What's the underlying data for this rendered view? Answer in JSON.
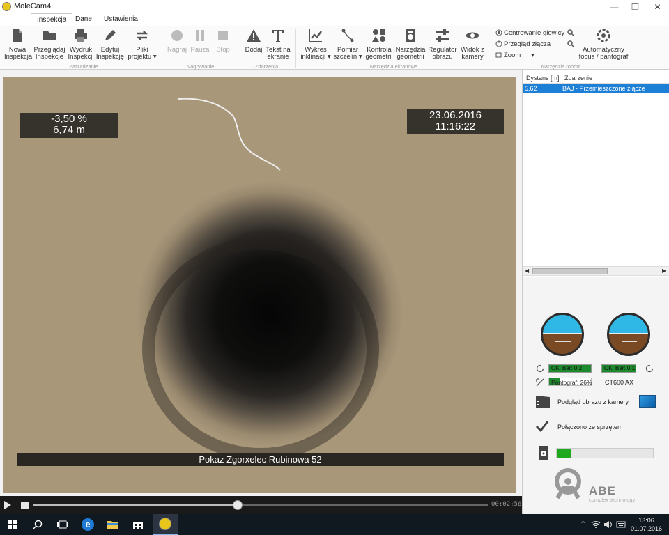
{
  "window": {
    "title": "MoleCam4",
    "minimize_glyph": "—",
    "restore_glyph": "❐",
    "close_glyph": "✕"
  },
  "tabs": [
    {
      "label": "Inspekcja",
      "active": true
    },
    {
      "label": "Dane",
      "active": false
    },
    {
      "label": "Ustawienia",
      "active": false
    }
  ],
  "ribbon": {
    "groups": {
      "zarzadzanie": "Zarządzanie",
      "nagrywanie": "Nagrywanie",
      "zdarzenia": "Zdarzenia",
      "narzedzia_ekranowe": "Narzędzia ekranowe",
      "narzedzia_robota": "Narzędzia robota"
    },
    "buttons": {
      "nowa": [
        "Nowa",
        "Inspekcja"
      ],
      "przegladaj": [
        "Przeglądaj",
        "Inspekcje"
      ],
      "wydruk": [
        "Wydruk",
        "Inspekcji"
      ],
      "edytuj": [
        "Edytuj",
        "Inspekcję"
      ],
      "pliki": [
        "Pliki",
        "projektu ▾"
      ],
      "nagraj": "Nagraj",
      "pauza": "Pauza",
      "stop": "Stop",
      "dodaj": "Dodaj",
      "tekst": [
        "Tekst na",
        "ekranie"
      ],
      "wykres": [
        "Wykres",
        "inklinacji ▾"
      ],
      "pomiar": [
        "Pomiar",
        "szczelin ▾"
      ],
      "kontrola": [
        "Kontrola",
        "geometrii"
      ],
      "narzedzia_geo": [
        "Narzędzia",
        "geometrii"
      ],
      "regulator": [
        "Regulator",
        "obrazu"
      ],
      "widok": [
        "Widok z",
        "kamery"
      ],
      "centrowanie": "Centrowanie głowicy",
      "przeglad_zlacza": "Przegląd złącza",
      "zoom": "Zoom",
      "zoom_arrow": "▾",
      "autofocus": [
        "Automatyczny",
        "focus / pantograf"
      ]
    }
  },
  "video": {
    "inclination": "-3,50 %",
    "distance": "6,74 m",
    "date": "23.06.2016",
    "time": "11:16:22",
    "banner": "Pokaz Zgorxelec Rubinowa 52"
  },
  "player": {
    "elapsed": "00:02:56",
    "progress": 0.45
  },
  "events": {
    "columns": [
      "Dystans [m]",
      "Zdarzenie"
    ],
    "rows": [
      {
        "distance": "5,62",
        "event": "BAJ - Przemieszczone złącze",
        "selected": true
      }
    ]
  },
  "status": {
    "bar_left": "OK, Bar: 0.2",
    "bar_right": "OK, Bar: 0.1",
    "pantograf": "Pantograf: 26%",
    "pantograf_value": 0.26,
    "model": "CT600 AX",
    "preview_label": "Podgląd obrazu z kamery",
    "connected_label": "Połączono ze sprzętem",
    "storage_progress": 0.15,
    "logo": "ABE",
    "logo_sub": "complex technology"
  },
  "colors": {
    "accent": "#1e7fd6",
    "ok_green": "#1e8a2e",
    "sky": "#2fb7e6",
    "ground": "#7a4a24"
  },
  "taskbar": {
    "items": [
      "windows-icon",
      "search-icon",
      "task-view-icon",
      "edge-icon",
      "explorer-icon",
      "store-icon",
      "molecam-icon"
    ],
    "tray_up": "⌃",
    "time": "13:06",
    "date": "01.07.2016"
  }
}
